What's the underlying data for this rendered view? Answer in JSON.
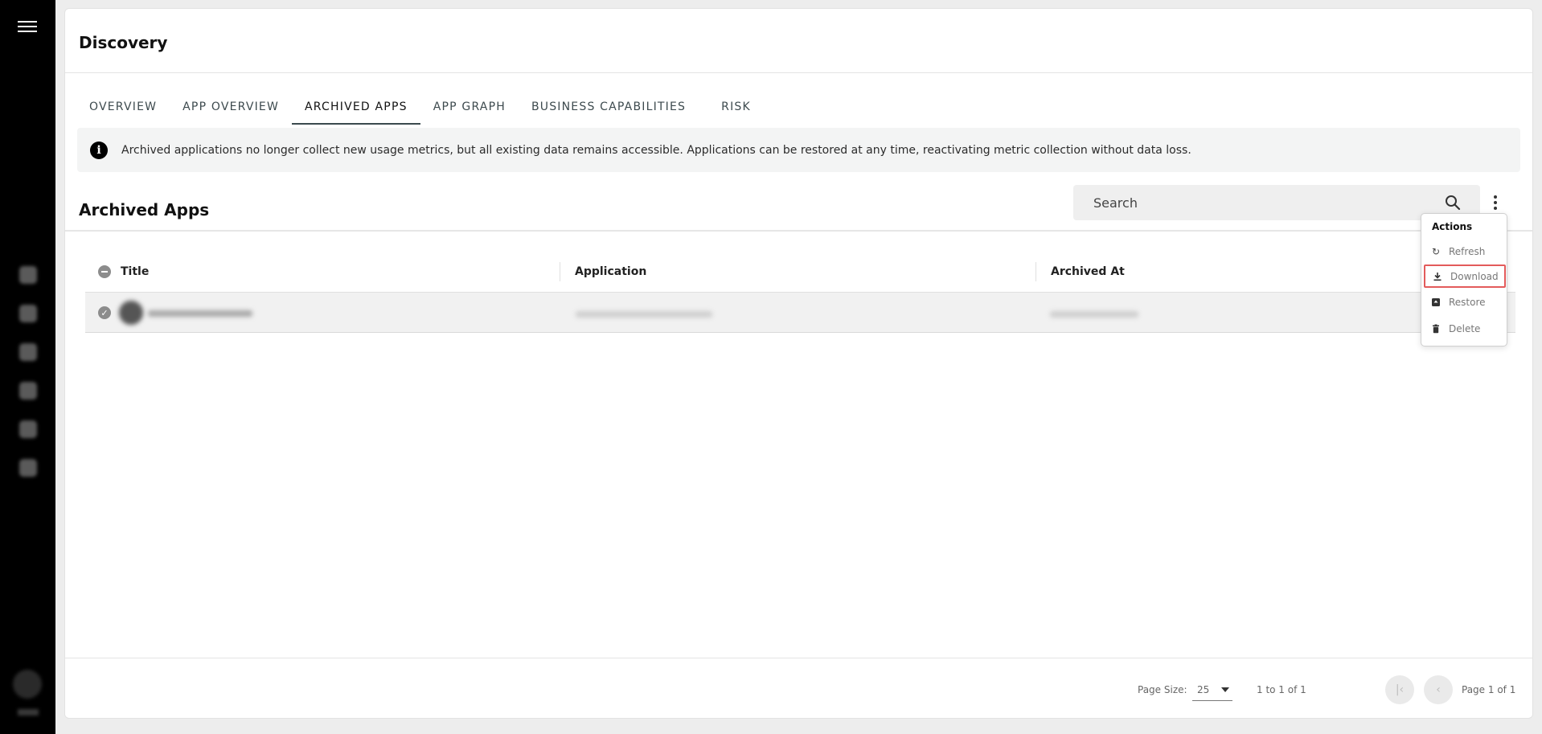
{
  "sidebar": {
    "icons": [
      "menu-icon",
      "dashboard-icon",
      "search-icon",
      "plus-icon",
      "inbox-icon",
      "star-icon",
      "settings-icon"
    ]
  },
  "header": {
    "title": "Discovery"
  },
  "tabs": [
    {
      "label": "OVERVIEW",
      "active": false
    },
    {
      "label": "APP OVERVIEW",
      "active": false
    },
    {
      "label": "ARCHIVED APPS",
      "active": true
    },
    {
      "label": "APP GRAPH",
      "active": false
    },
    {
      "label": "BUSINESS CAPABILITIES",
      "active": false
    },
    {
      "label": "RISK",
      "active": false
    }
  ],
  "info": {
    "message": "Archived applications no longer collect new usage metrics, but all existing data remains accessible. Applications can be restored at any time, reactivating metric collection without data loss."
  },
  "section": {
    "title": "Archived Apps"
  },
  "search": {
    "placeholder": "Search"
  },
  "table": {
    "columns": [
      "Title",
      "Application",
      "Archived At"
    ]
  },
  "actions_menu": {
    "title": "Actions",
    "items": [
      {
        "label": "Refresh",
        "icon": "refresh-icon"
      },
      {
        "label": "Download",
        "icon": "download-icon",
        "highlighted": true
      },
      {
        "label": "Restore",
        "icon": "restore-icon"
      },
      {
        "label": "Delete",
        "icon": "trash-icon"
      }
    ]
  },
  "pagination": {
    "page_size_label": "Page Size:",
    "page_size_value": "25",
    "summary": "1 to 1 of 1",
    "page_label": "Page 1 of 1"
  },
  "colors": {
    "rail": "#000000",
    "highlight": "#e35b5b",
    "active_tab_underline": "#3b4a4e"
  }
}
